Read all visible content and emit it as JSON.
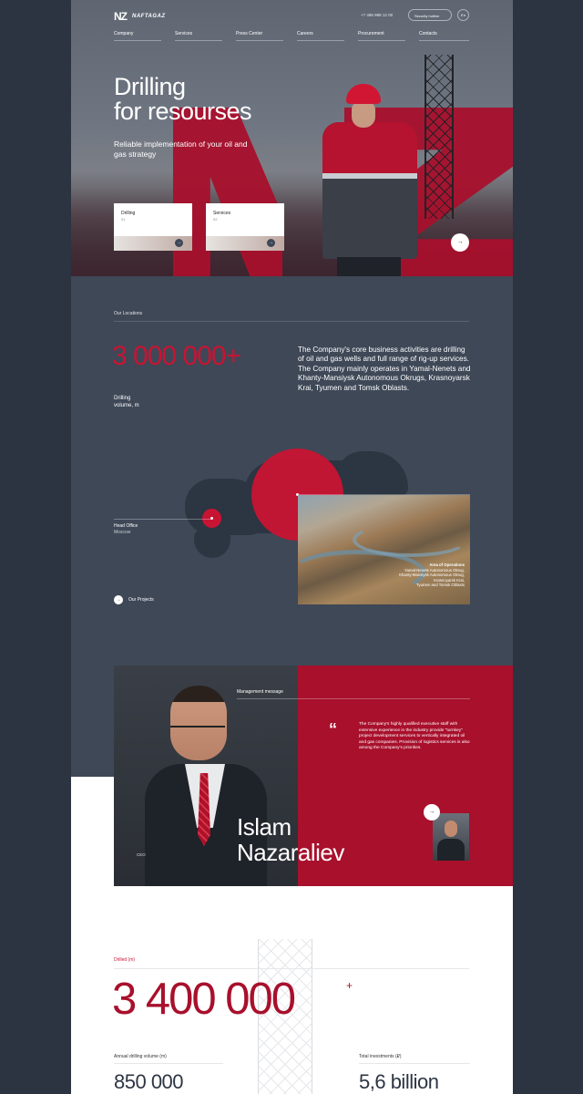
{
  "brand": {
    "mark": "NZ",
    "name": "NAFTAGAZ"
  },
  "header": {
    "hotline": "+7 495 988 12 00",
    "security_label": "Security hotline",
    "lang": "En"
  },
  "nav": [
    "Company",
    "Services",
    "Press Center",
    "Careers",
    "Procurement",
    "Contacts"
  ],
  "hero": {
    "title_line1": "Drilling",
    "title_line2": "for resourses",
    "subtitle": "Reliable implementation of your oil and gas strategy",
    "cards": [
      {
        "title": "Drilling",
        "num": "01"
      },
      {
        "title": "Services",
        "num": "02"
      }
    ],
    "arrow": "→"
  },
  "locations": {
    "label": "Our Locations",
    "metric_value": "3 000 000+",
    "metric_label_1": "Drilling",
    "metric_label_2": "volume, m",
    "description": "The Company's core business activities are drilling of oil and gas wells and full range of rig-up services. The Company mainly operates in Yamal-Nenets and Khanty-Mansiysk Autonomous Okrugs, Krasnoyarsk Krai, Tyumen and Tomsk Oblasts.",
    "head_office": "Head Office",
    "head_office_city": "Moscow",
    "area_title": "Area of Operations",
    "area_lines": [
      "Yamal-Nenets Autonomous Okrug,",
      "Khanty-Mansiysk Autonomous Okrug,",
      "Krasnoyarsk Krai,",
      "Tyumen and Tomsk Oblasts"
    ],
    "projects_label": "Our Projects",
    "projects_arrow": "→"
  },
  "management": {
    "label": "Management message",
    "quote_mark": "“",
    "quote": "The Company's highly qualified executive staff with extensive experience in the industry provide \"turnkey\" project development services to vertically integrated oil and gas companies. Provision of logistics services is also among the Company's priorities.",
    "name_line1": "Islam",
    "name_line2": "Nazaraliev",
    "role": "CEO",
    "arrow": "→"
  },
  "stats": {
    "drilled_label": "Drilled (m)",
    "drilled_value": "3 400 000",
    "drilled_plus": "+",
    "annual_label": "Annual drilling volume (m)",
    "annual_value": "850 000",
    "invest_label": "Total investments (₽)",
    "invest_value": "5,6 billion"
  },
  "colors": {
    "brand_red": "#a8102c",
    "accent_red": "#c81433",
    "slate": "#3e4857",
    "outer": "#2b3440"
  }
}
